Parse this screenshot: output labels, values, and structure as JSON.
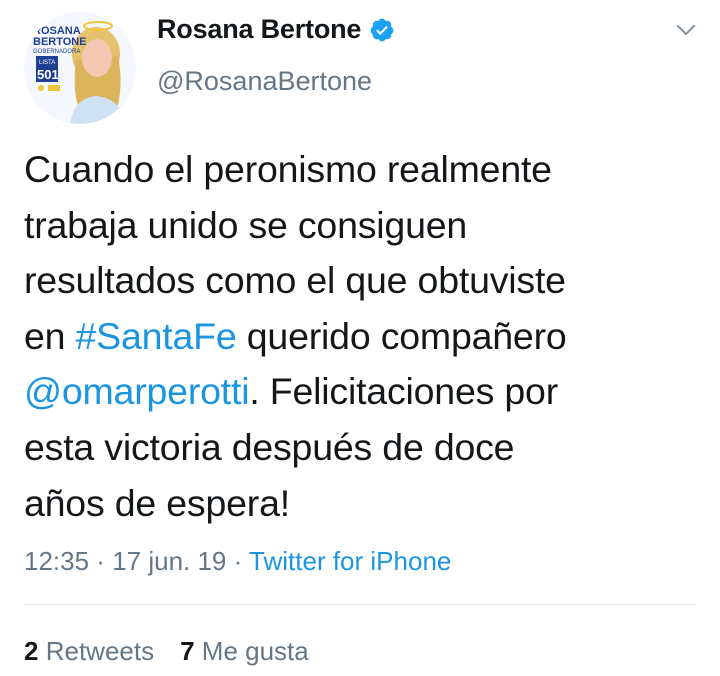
{
  "author": {
    "display_name": "Rosana Bertone",
    "handle": "@RosanaBertone",
    "avatar_text": {
      "line1": "ROSANA",
      "line2": "BERTONE",
      "line3": "GOBERNADORA",
      "list_label": "LISTA",
      "list_number": "501"
    }
  },
  "tweet": {
    "line1": "Cuando el peronismo realmente",
    "line2": "trabaja unido se consiguen",
    "line3": "resultados como el que obtuviste",
    "line4_pre": "en ",
    "hashtag": "#SantaFe",
    "line4_post": " querido compañero",
    "mention": "@omarperotti",
    "line5_post": ". Felicitaciones por",
    "line6": "esta victoria después de doce",
    "line7": "años de espera!"
  },
  "meta": {
    "time": "12:35",
    "date": "17 jun. 19",
    "separator": " · ",
    "source": "Twitter for iPhone"
  },
  "stats": {
    "retweets_count": "2",
    "retweets_label": "Retweets",
    "likes_count": "7",
    "likes_label": "Me gusta"
  },
  "colors": {
    "link": "#1b95e0",
    "secondary_text": "#657786",
    "primary_text": "#14171a",
    "verified": "#1da1f2",
    "divider": "#e1e8ed"
  },
  "icons": {
    "verified": "verified-badge-icon",
    "menu": "chevron-down-icon"
  }
}
